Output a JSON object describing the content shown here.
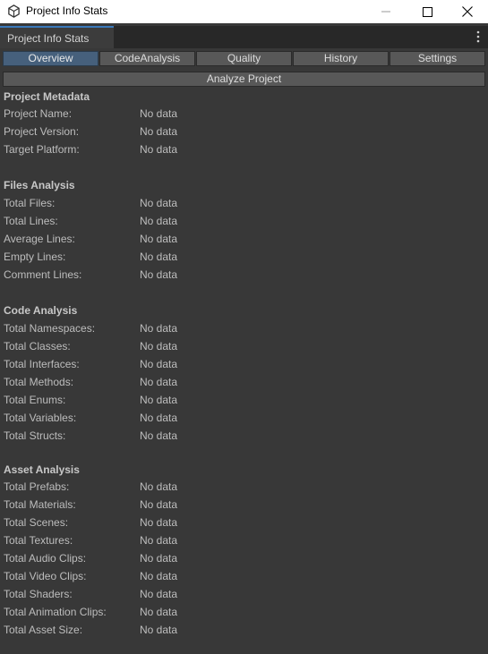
{
  "window": {
    "title": "Project Info Stats",
    "tab_label": "Project Info Stats"
  },
  "tabs": [
    {
      "label": "Overview",
      "active": true
    },
    {
      "label": "CodeAnalysis",
      "active": false
    },
    {
      "label": "Quality",
      "active": false
    },
    {
      "label": "History",
      "active": false
    },
    {
      "label": "Settings",
      "active": false
    }
  ],
  "analyze_button": "Analyze Project",
  "sections": [
    {
      "title": "Project Metadata",
      "rows": [
        {
          "label": "Project Name:",
          "value": "No data"
        },
        {
          "label": "Project Version:",
          "value": "No data"
        },
        {
          "label": "Target Platform:",
          "value": "No data"
        }
      ]
    },
    {
      "title": "Files Analysis",
      "rows": [
        {
          "label": "Total Files:",
          "value": "No data"
        },
        {
          "label": "Total Lines:",
          "value": "No data"
        },
        {
          "label": "Average Lines:",
          "value": "No data"
        },
        {
          "label": "Empty Lines:",
          "value": "No data"
        },
        {
          "label": "Comment Lines:",
          "value": "No data"
        }
      ]
    },
    {
      "title": "Code Analysis",
      "rows": [
        {
          "label": "Total Namespaces:",
          "value": "No data"
        },
        {
          "label": "Total Classes:",
          "value": "No data"
        },
        {
          "label": "Total Interfaces:",
          "value": "No data"
        },
        {
          "label": "Total Methods:",
          "value": "No data"
        },
        {
          "label": "Total Enums:",
          "value": "No data"
        },
        {
          "label": "Total Variables:",
          "value": "No data"
        },
        {
          "label": "Total Structs:",
          "value": "No data"
        }
      ]
    },
    {
      "title": "Asset Analysis",
      "rows": [
        {
          "label": "Total Prefabs:",
          "value": "No data"
        },
        {
          "label": "Total Materials:",
          "value": "No data"
        },
        {
          "label": "Total Scenes:",
          "value": "No data"
        },
        {
          "label": "Total Textures:",
          "value": "No data"
        },
        {
          "label": "Total Audio Clips:",
          "value": "No data"
        },
        {
          "label": "Total Video Clips:",
          "value": "No data"
        },
        {
          "label": "Total Shaders:",
          "value": "No data"
        },
        {
          "label": "Total Animation Clips:",
          "value": "No data"
        },
        {
          "label": "Total Asset Size:",
          "value": "No data"
        }
      ]
    }
  ],
  "icons": {
    "app": "unity-cube-icon",
    "minimize": "minimize-icon",
    "maximize": "maximize-icon",
    "close": "close-icon",
    "menu": "kebab-menu-icon"
  }
}
